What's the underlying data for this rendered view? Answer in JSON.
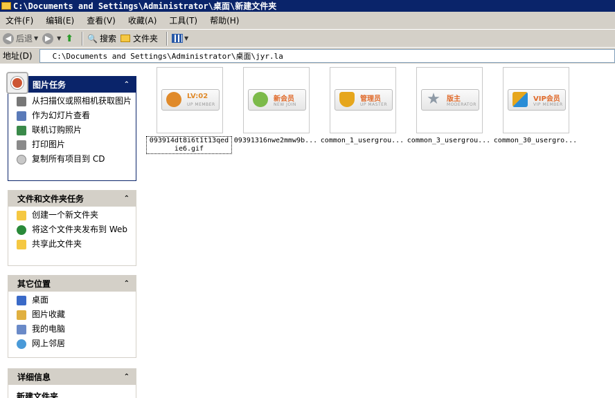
{
  "window": {
    "title": "C:\\Documents and Settings\\Administrator\\桌面\\新建文件夹"
  },
  "menu": [
    "文件(F)",
    "编辑(E)",
    "查看(V)",
    "收藏(A)",
    "工具(T)",
    "帮助(H)"
  ],
  "toolbar": {
    "back": "后退",
    "search": "搜索",
    "folders": "文件夹"
  },
  "address": {
    "label": "地址(D)",
    "value": "C:\\Documents and Settings\\Administrator\\桌面\\jyr.la"
  },
  "panels": {
    "picture_tasks": {
      "title": "图片任务",
      "items": [
        "从扫描仪或照相机获取图片",
        "作为幻灯片查看",
        "联机订购照片",
        "打印图片",
        "复制所有项目到 CD"
      ]
    },
    "file_tasks": {
      "title": "文件和文件夹任务",
      "items": [
        "创建一个新文件夹",
        "将这个文件夹发布到 Web",
        "共享此文件夹"
      ]
    },
    "other_places": {
      "title": "其它位置",
      "items": [
        "桌面",
        "图片收藏",
        "我的电脑",
        "网上邻居"
      ]
    },
    "details": {
      "title": "详细信息",
      "name": "新建文件夹"
    }
  },
  "files": [
    {
      "name": "093914dt8i6t1t13qedie6.gif",
      "badge_main": "LV:02",
      "badge_sub": "UP MEMBER",
      "accent": "#e08a2a",
      "icon": "medal-icon"
    },
    {
      "name": "09391316nwe2mmw9b...",
      "badge_main": "新会员",
      "badge_sub": "NEW JOIN",
      "accent": "#7cba4a",
      "icon": "tag-icon"
    },
    {
      "name": "common_1_usergrou...",
      "badge_main": "管理员",
      "badge_sub": "UP MASTER",
      "accent": "#e6a61c",
      "icon": "shield-icon"
    },
    {
      "name": "common_3_usergrou...",
      "badge_main": "版主",
      "badge_sub": "MODERATOR",
      "accent": "#8e9aa6",
      "icon": "star-icon"
    },
    {
      "name": "common_30_usergro...",
      "badge_main": "VIP会员",
      "badge_sub": "VIP MEMBER",
      "accent": "#2a8dd6",
      "icon": "cubes-icon"
    }
  ]
}
